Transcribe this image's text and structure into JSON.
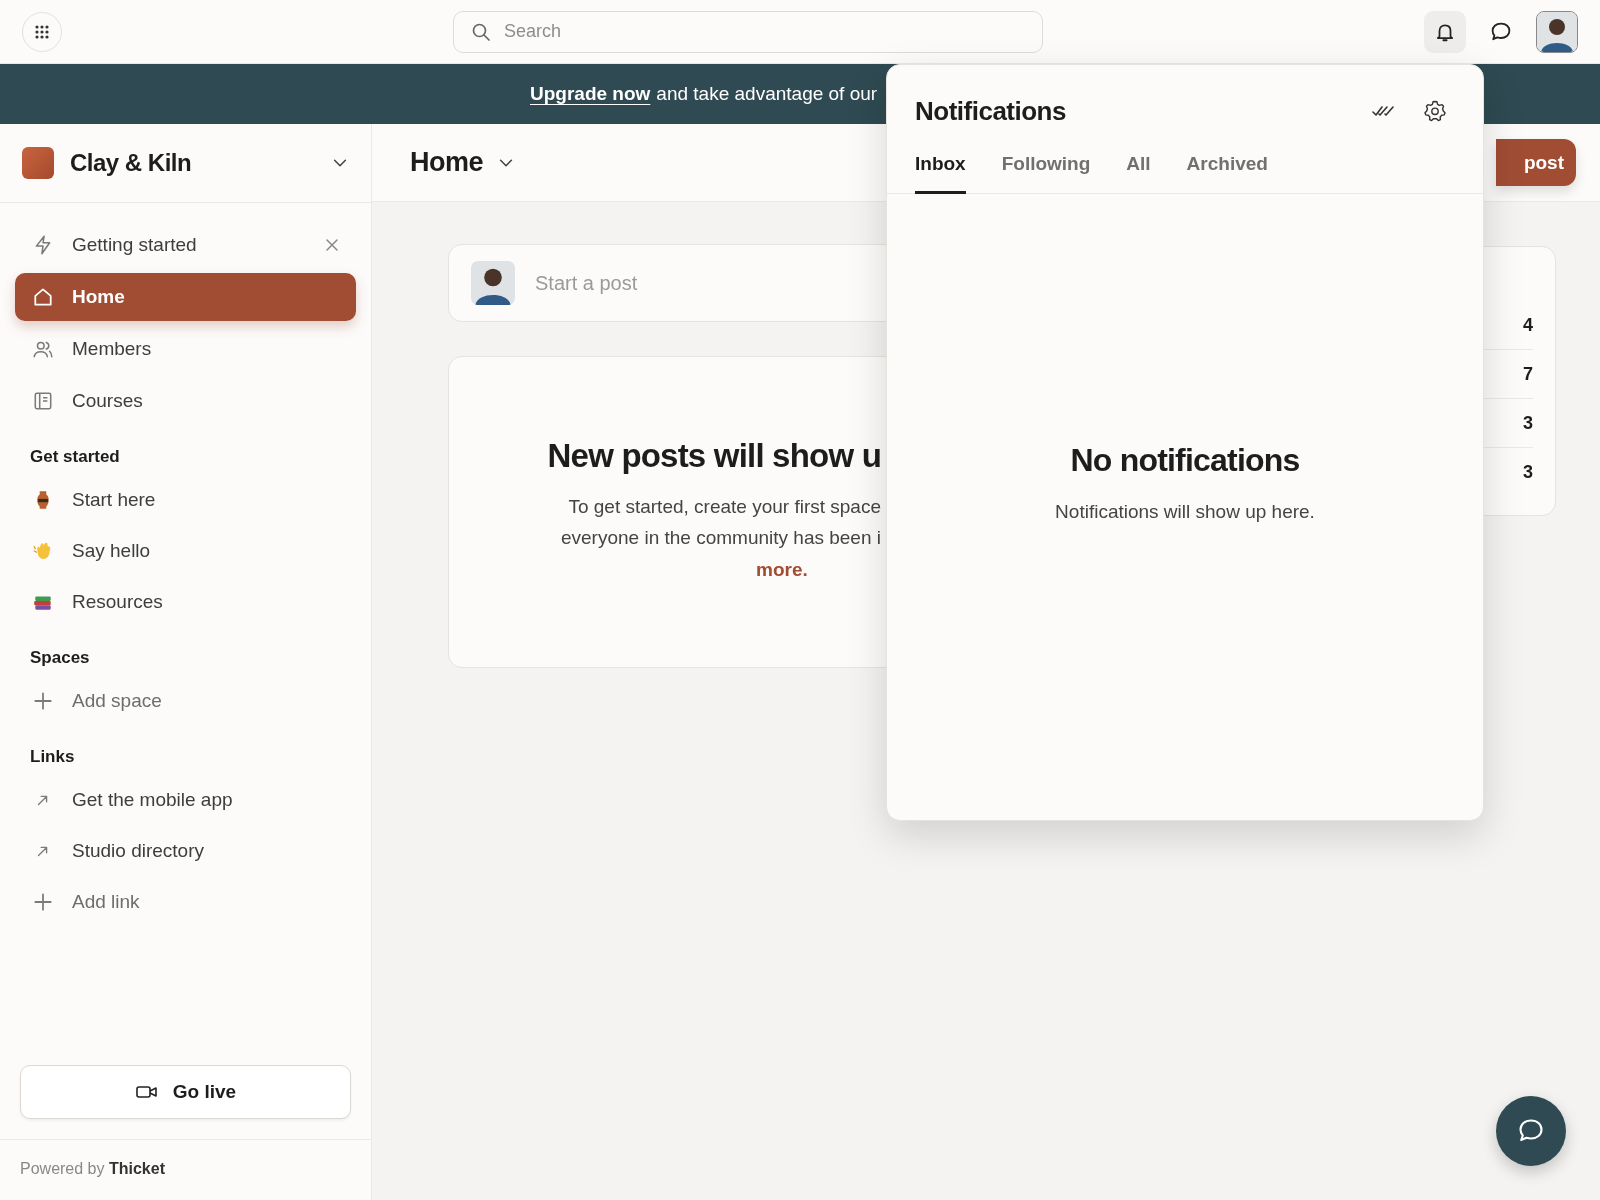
{
  "top_bar": {
    "search": {
      "placeholder": "Search"
    }
  },
  "banner": {
    "link": "Upgrade now",
    "text": "and take advantage of our"
  },
  "sidebar": {
    "community": "Clay & Kiln",
    "nav": [
      {
        "label": "Getting started",
        "kind": "bolt",
        "selected": false,
        "closable": true
      },
      {
        "label": "Home",
        "kind": "home",
        "selected": true,
        "closable": false
      },
      {
        "label": "Members",
        "kind": "members",
        "selected": false,
        "closable": false
      },
      {
        "label": "Courses",
        "kind": "courses",
        "selected": false,
        "closable": false
      }
    ],
    "sections": [
      {
        "title": "Get started",
        "items": [
          {
            "label": "Start here",
            "kind": "vase"
          },
          {
            "label": "Say hello",
            "kind": "wave"
          },
          {
            "label": "Resources",
            "kind": "books"
          }
        ]
      },
      {
        "title": "Spaces",
        "items": [
          {
            "label": "Add space",
            "kind": "add"
          }
        ]
      },
      {
        "title": "Links",
        "items": [
          {
            "label": "Get the mobile app",
            "kind": "link"
          },
          {
            "label": "Studio directory",
            "kind": "link"
          },
          {
            "label": "Add link",
            "kind": "add"
          }
        ]
      }
    ],
    "go_live": "Go live",
    "powered_by": "Powered by **Thicket**"
  },
  "header": {
    "title": "Home",
    "new_post_button": "post"
  },
  "composer": {
    "placeholder": "Start a post"
  },
  "empty_state": {
    "title": "New posts will show u",
    "lines": [
      "To get started, create your first space",
      "everyone in the community has been i"
    ],
    "link": "more."
  },
  "stats": [
    "4",
    "7",
    "3",
    "3"
  ],
  "notifications": {
    "title": "Notifications",
    "tabs": [
      {
        "label": "Inbox",
        "selected": true
      },
      {
        "label": "Following",
        "selected": false
      },
      {
        "label": "All",
        "selected": false
      },
      {
        "label": "Archived",
        "selected": false
      }
    ],
    "empty_title": "No notifications",
    "empty_text": "Notifications will show up here."
  }
}
